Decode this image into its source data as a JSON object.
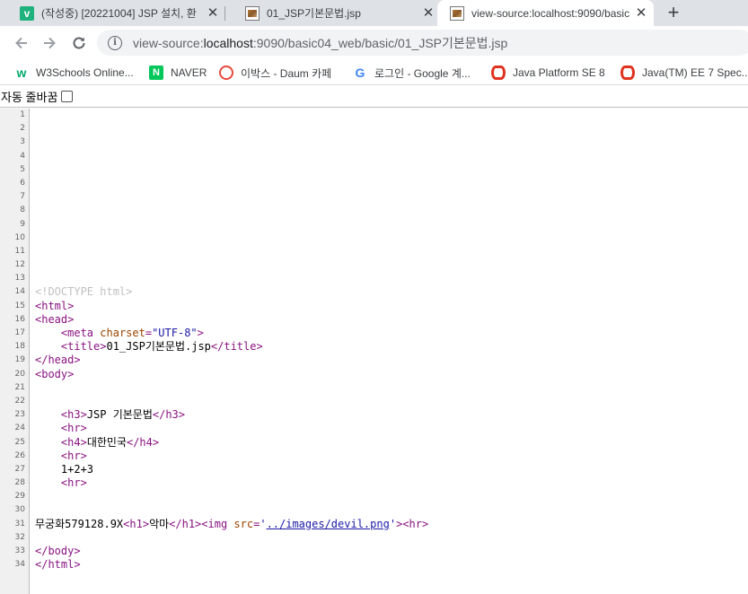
{
  "tabs": [
    {
      "title": "(작성중) [20221004] JSP 설치, 환",
      "favicon": "v-icon",
      "active": false
    },
    {
      "title": "01_JSP기본문법.jsp",
      "favicon": "jsp-image-icon",
      "active": false
    },
    {
      "title": "view-source:localhost:9090/basic",
      "favicon": "jsp-image-icon",
      "active": true
    }
  ],
  "toolbar": {
    "url_prefix": "view-source:",
    "url_host": "localhost",
    "url_rest": ":9090/basic04_web/basic/01_JSP기본문법.jsp"
  },
  "bookmarks": [
    {
      "label": "W3Schools Online...",
      "icon": "w3schools-icon"
    },
    {
      "label": "NAVER",
      "icon": "naver-icon"
    },
    {
      "label": "이박스 - Daum 카페",
      "icon": "daum-cafe-icon"
    },
    {
      "label": "로그인 - Google 계...",
      "icon": "google-icon"
    },
    {
      "label": "Java Platform SE 8",
      "icon": "oracle-icon"
    },
    {
      "label": "Java(TM) EE 7 Spec...",
      "icon": "oracle-icon"
    }
  ],
  "wrap": {
    "label": "자동 줄바꿈",
    "checked": false
  },
  "source_lines": [
    {
      "n": "1",
      "tokens": []
    },
    {
      "n": "2",
      "tokens": []
    },
    {
      "n": "3",
      "tokens": []
    },
    {
      "n": "4",
      "tokens": []
    },
    {
      "n": "5",
      "tokens": []
    },
    {
      "n": "6",
      "tokens": []
    },
    {
      "n": "7",
      "tokens": []
    },
    {
      "n": "8",
      "tokens": []
    },
    {
      "n": "9",
      "tokens": []
    },
    {
      "n": "10",
      "tokens": []
    },
    {
      "n": "11",
      "tokens": []
    },
    {
      "n": "12",
      "tokens": []
    },
    {
      "n": "13",
      "tokens": []
    },
    {
      "n": "14",
      "tokens": [
        {
          "t": "doctype",
          "v": "<!DOCTYPE html>"
        }
      ]
    },
    {
      "n": "15",
      "tokens": [
        {
          "t": "tag",
          "v": "<html>"
        }
      ]
    },
    {
      "n": "16",
      "tokens": [
        {
          "t": "tag",
          "v": "<head>"
        }
      ]
    },
    {
      "n": "17",
      "tokens": [
        {
          "t": "text",
          "v": "    "
        },
        {
          "t": "tag",
          "v": "<meta "
        },
        {
          "t": "attr",
          "v": "charset"
        },
        {
          "t": "tag",
          "v": "="
        },
        {
          "t": "val",
          "v": "\"UTF-8\""
        },
        {
          "t": "tag",
          "v": ">"
        }
      ]
    },
    {
      "n": "18",
      "tokens": [
        {
          "t": "text",
          "v": "    "
        },
        {
          "t": "tag",
          "v": "<title>"
        },
        {
          "t": "text",
          "v": "01_JSP기본문법.jsp"
        },
        {
          "t": "tag",
          "v": "</title>"
        }
      ]
    },
    {
      "n": "19",
      "tokens": [
        {
          "t": "tag",
          "v": "</head>"
        }
      ]
    },
    {
      "n": "20",
      "tokens": [
        {
          "t": "tag",
          "v": "<body>"
        }
      ]
    },
    {
      "n": "21",
      "tokens": []
    },
    {
      "n": "22",
      "tokens": []
    },
    {
      "n": "23",
      "tokens": [
        {
          "t": "text",
          "v": "    "
        },
        {
          "t": "tag",
          "v": "<h3>"
        },
        {
          "t": "text",
          "v": "JSP 기본문법"
        },
        {
          "t": "tag",
          "v": "</h3>"
        }
      ]
    },
    {
      "n": "24",
      "tokens": [
        {
          "t": "text",
          "v": "    "
        },
        {
          "t": "tag",
          "v": "<hr>"
        }
      ]
    },
    {
      "n": "25",
      "tokens": [
        {
          "t": "text",
          "v": "    "
        },
        {
          "t": "tag",
          "v": "<h4>"
        },
        {
          "t": "text",
          "v": "대한민국"
        },
        {
          "t": "tag",
          "v": "</h4>"
        }
      ]
    },
    {
      "n": "26",
      "tokens": [
        {
          "t": "text",
          "v": "    "
        },
        {
          "t": "tag",
          "v": "<hr>"
        }
      ]
    },
    {
      "n": "27",
      "tokens": [
        {
          "t": "text",
          "v": "    1+2+3"
        }
      ]
    },
    {
      "n": "28",
      "tokens": [
        {
          "t": "text",
          "v": "    "
        },
        {
          "t": "tag",
          "v": "<hr>"
        }
      ]
    },
    {
      "n": "29",
      "tokens": []
    },
    {
      "n": "30",
      "tokens": []
    },
    {
      "n": "31",
      "tokens": [
        {
          "t": "text",
          "v": "무궁화579128.9X"
        },
        {
          "t": "tag",
          "v": "<h1>"
        },
        {
          "t": "text",
          "v": "악마"
        },
        {
          "t": "tag",
          "v": "</h1>"
        },
        {
          "t": "tag",
          "v": "<img "
        },
        {
          "t": "attr",
          "v": "src"
        },
        {
          "t": "tag",
          "v": "="
        },
        {
          "t": "val",
          "v": "'"
        },
        {
          "t": "link",
          "v": "../images/devil.png"
        },
        {
          "t": "val",
          "v": "'"
        },
        {
          "t": "tag",
          "v": ">"
        },
        {
          "t": "tag",
          "v": "<hr>"
        }
      ]
    },
    {
      "n": "32",
      "tokens": []
    },
    {
      "n": "33",
      "tokens": [
        {
          "t": "tag",
          "v": "</body>"
        }
      ]
    },
    {
      "n": "34",
      "tokens": [
        {
          "t": "tag",
          "v": "</html>"
        }
      ]
    }
  ]
}
